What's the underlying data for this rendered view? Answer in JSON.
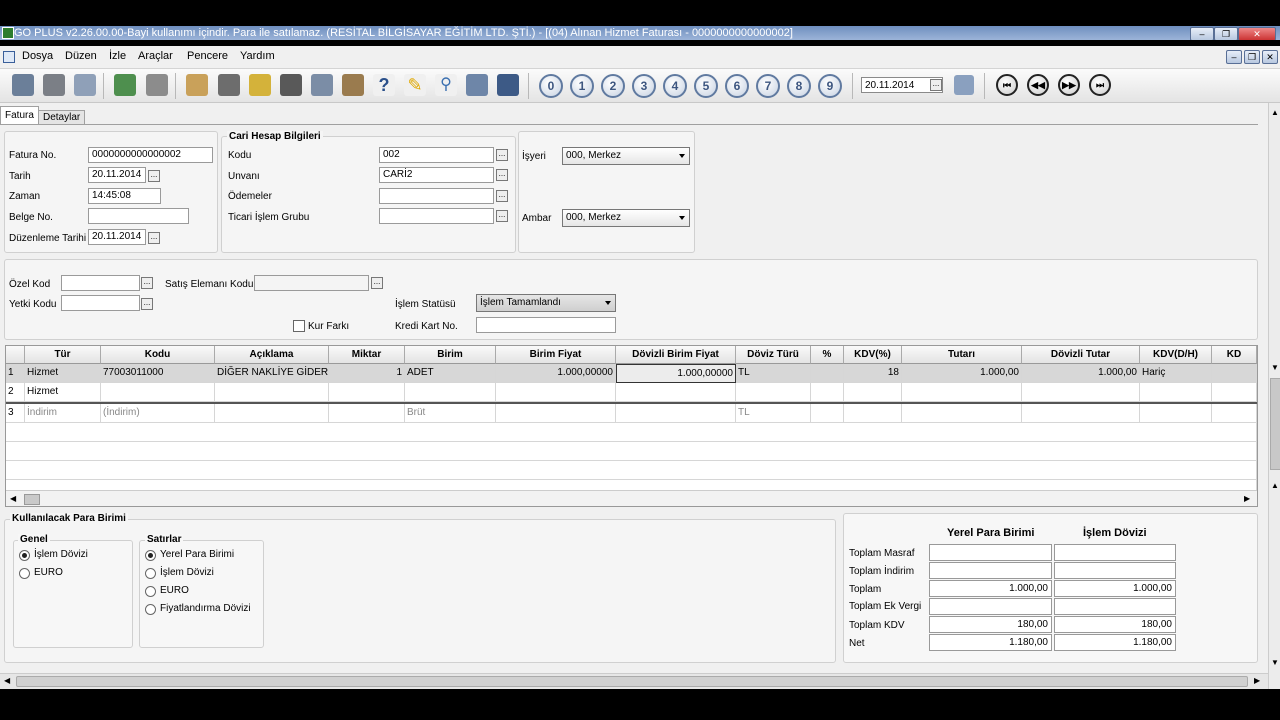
{
  "window": {
    "title": "GO PLUS v2.26.00.00-Bayi kullanımı içindir. Para ile satılamaz. (RESİTAL BİLGİSAYAR EĞİTİM LTD. ŞTİ.) - [(04) Alınan Hizmet Faturası - 0000000000000002]"
  },
  "menu": {
    "items": [
      "Dosya",
      "Düzen",
      "İzle",
      "Araçlar",
      "Pencere",
      "Yardım"
    ]
  },
  "toolbar": {
    "numbers": [
      "0",
      "1",
      "2",
      "3",
      "4",
      "5",
      "6",
      "7",
      "8",
      "9"
    ],
    "date": "20.11.2014"
  },
  "tabs": [
    "Fatura",
    "Detaylar"
  ],
  "fatura": {
    "no_label": "Fatura No.",
    "no": "0000000000000002",
    "tarih_label": "Tarih",
    "tarih": "20.11.2014",
    "zaman_label": "Zaman",
    "zaman": "14:45:08",
    "belge_label": "Belge No.",
    "belge": "",
    "duzenleme_label": "Düzenleme Tarihi",
    "duzenleme": "20.11.2014"
  },
  "cari": {
    "title": "Cari Hesap Bilgileri",
    "kodu_label": "Kodu",
    "kodu": "002",
    "unvan_label": "Unvanı",
    "unvan": "CARİ2",
    "odemeler_label": "Ödemeler",
    "odemeler": "",
    "ticari_label": "Ticari İşlem Grubu",
    "ticari": ""
  },
  "isyeri": {
    "label": "İşyeri",
    "value": "000, Merkez",
    "ambar_label": "Ambar",
    "ambar": "000, Merkez"
  },
  "extra": {
    "ozel_kod_label": "Özel Kod",
    "yetki_kodu_label": "Yetki Kodu",
    "satis_label": "Satış Elemanı Kodu",
    "kur_farki_label": "Kur Farkı",
    "statu_label": "İşlem Statüsü",
    "statu": "İşlem Tamamlandı",
    "kredi_label": "Kredi Kart No."
  },
  "grid": {
    "headers": [
      "Tür",
      "Kodu",
      "Açıklama",
      "Miktar",
      "Birim",
      "Birim Fiyat",
      "Dövizli Birim Fiyat",
      "Döviz Türü",
      "%",
      "KDV(%)",
      "Tutarı",
      "Dövizli Tutar",
      "KDV(D/H)",
      "KD"
    ],
    "rows": [
      {
        "n": "1",
        "tur": "Hizmet",
        "kodu": "77003011000",
        "aciklama": "DİĞER NAKLİYE GİDERLİ",
        "miktar": "1",
        "birim": "ADET",
        "fiyat": "1.000,00000",
        "dfiyat": "1.000,00000",
        "doviz": "TL",
        "yuzde": "",
        "kdv": "18",
        "tutar": "1.000,00",
        "dtutar": "1.000,00",
        "kdvdh": "Hariç"
      },
      {
        "n": "2",
        "tur": "Hizmet",
        "kodu": "",
        "aciklama": "",
        "miktar": "",
        "birim": "",
        "fiyat": "",
        "dfiyat": "",
        "doviz": "",
        "yuzde": "",
        "kdv": "",
        "tutar": "",
        "dtutar": "",
        "kdvdh": ""
      },
      {
        "n": "3",
        "tur": "İndirim",
        "kodu": "(İndirim)",
        "aciklama": "",
        "miktar": "",
        "birim": "Brüt",
        "fiyat": "",
        "dfiyat": "",
        "doviz": "TL",
        "yuzde": "",
        "kdv": "",
        "tutar": "",
        "dtutar": "",
        "kdvdh": ""
      }
    ]
  },
  "para": {
    "title": "Kullanılacak Para Birimi",
    "genel_title": "Genel",
    "genel": [
      "İşlem Dövizi",
      "EURO"
    ],
    "satirlar_title": "Satırlar",
    "satirlar": [
      "Yerel Para Birimi",
      "İşlem Dövizi",
      "EURO",
      "Fiyatlandırma Dövizi"
    ]
  },
  "totals": {
    "col1": "Yerel Para Birimi",
    "col2": "İşlem Dövizi",
    "rows": [
      {
        "label": "Toplam Masraf",
        "v1": "",
        "v2": ""
      },
      {
        "label": "Toplam İndirim",
        "v1": "",
        "v2": ""
      },
      {
        "label": "Toplam",
        "v1": "1.000,00",
        "v2": "1.000,00"
      },
      {
        "label": "Toplam Ek Vergi",
        "v1": "",
        "v2": ""
      },
      {
        "label": "Toplam KDV",
        "v1": "180,00",
        "v2": "180,00"
      },
      {
        "label": "Net",
        "v1": "1.180,00",
        "v2": "1.180,00"
      }
    ]
  }
}
